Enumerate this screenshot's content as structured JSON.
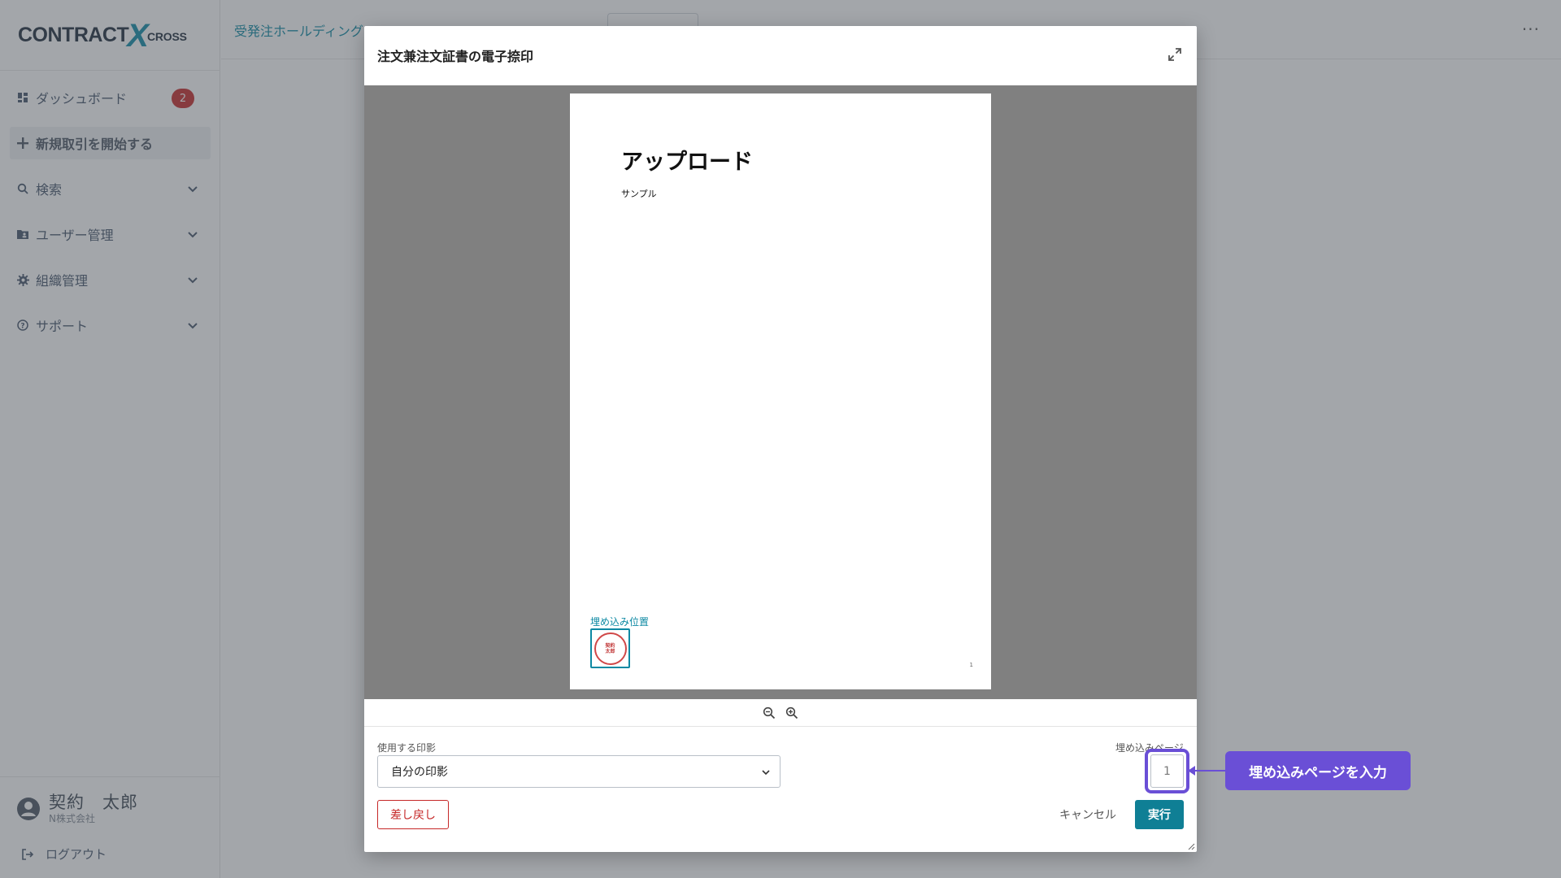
{
  "app": {
    "logo_part1": "CONTRACT",
    "logo_x": "X",
    "logo_part2": "CROSS"
  },
  "sidebar": {
    "items": [
      {
        "label": "ダッシュボード",
        "icon": "dashboard-icon",
        "badge": "2"
      },
      {
        "label": "新規取引を開始する",
        "icon": "plus-icon"
      },
      {
        "label": "検索",
        "icon": "search-icon"
      },
      {
        "label": "ユーザー管理",
        "icon": "folder-user-icon"
      },
      {
        "label": "組織管理",
        "icon": "gear-icon"
      },
      {
        "label": "サポート",
        "icon": "help-circle-icon"
      }
    ],
    "user_name": "契約　太郎",
    "user_company": "N株式会社",
    "logout_label": "ログアウト"
  },
  "header": {
    "breadcrumb": "受発注ホールディング",
    "title_fragment": "",
    "menu_glyph": "···"
  },
  "modal": {
    "title": "注文兼注文証書の電子捺印",
    "pdf": {
      "heading": "アップロード",
      "subtext": "サンプル",
      "page_number": "1",
      "stamp_label": "埋め込み位置",
      "stamp_line1": "契約",
      "stamp_line2": "太郎"
    },
    "seal_field_label": "使用する印影",
    "seal_selected": "自分の印影",
    "page_field_label": "埋め込みページ",
    "page_value": "1",
    "return_button": "差し戻し",
    "cancel_button": "キャンセル",
    "run_button": "実行"
  },
  "callout": {
    "text": "埋め込みページを入力",
    "color": "#6a4fd6"
  },
  "colors": {
    "accent": "#0d89a3",
    "primary_button": "#0f7f95",
    "danger": "#c62828",
    "badge": "#c62828"
  }
}
